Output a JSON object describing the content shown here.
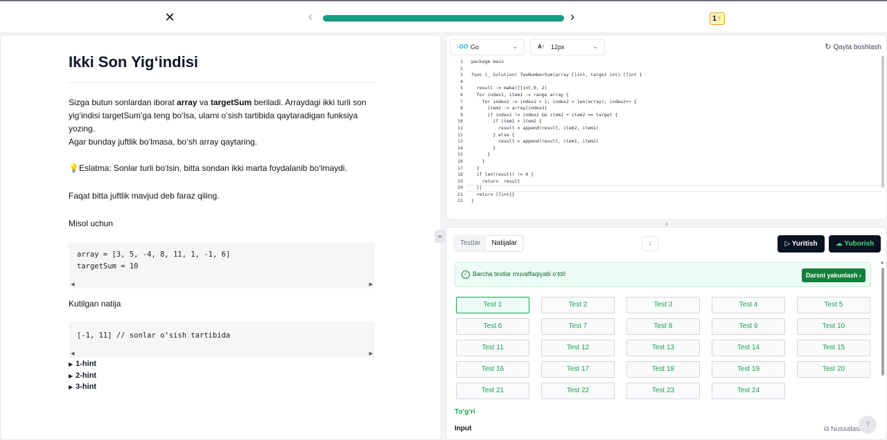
{
  "topbar": {
    "close_glyph": "✕",
    "prev_glyph": "‹",
    "next_glyph": "›",
    "progress_percent": 100,
    "streak_count": "1",
    "streak_icon": "lightning-icon"
  },
  "problem": {
    "title": "Ikki Son Yig‘indisi",
    "intro_1": "Sizga butun sonlardan iborat ",
    "intro_array": "array",
    "intro_2": " va ",
    "intro_target": "targetSum",
    "intro_3": " beriladi. Arraydagi ikki turli son yig‘indisi targetSum'ga teng bo‘lsa, ularni o‘sish tartibida qaytaradigan funksiya yozing.",
    "no_pair": "Agar bunday juftlik bo‘lmasa, bo‘sh array qaytaring.",
    "note_icon": "lightbulb-icon",
    "note": "Eslatma: Sonlar turli bo‘lsin, bitta sondan ikki marta foydalanib bo‘lmaydi.",
    "assume": "Faqat bitta juftlik mavjud deb faraz qiling.",
    "example_label": "Misol uchun",
    "example_code": "array = [3, 5, -4, 8, 11, 1, -1, 6]\ntargetSum = 10",
    "expected_label": "Kutilgan natija",
    "expected_code": "[-1, 11] // sonlar o‘sish tartibida",
    "hints": [
      "1-hint",
      "2-hint",
      "3-hint"
    ]
  },
  "editor": {
    "language": "Go",
    "font_size": "12px",
    "reset_label": "Qayta boshlash",
    "code_lines": [
      "package main",
      "",
      "func (_ Solution) TwoNumberSum(array []int, target int) []int {",
      "",
      "  result := make([]int,0, 2)",
      "  for index1, item1 := range array {",
      "    for index2 := index1 + 1; index2 < len(array); index2++ {",
      "      item2 := array[index2]",
      "      if index1 != index2 && item1 + item2 == target {",
      "        if item1 > item2 {",
      "          result = append(result, item2, item1)",
      "        } else {",
      "          result = append(result, item1, item2)",
      "        }",
      "      }",
      "    }",
      "  }",
      "  if len(result) != 0 {",
      "    return  result",
      "  }|",
      "  return []int{}",
      "}"
    ]
  },
  "results": {
    "tabs": [
      "Testlar",
      "Natijalar"
    ],
    "active_tab": "Natijalar",
    "run_label": "Yuritish",
    "submit_label": "Yuborish",
    "success_message": "Barcha testlar muvaffaqiyatli o‘tdi!",
    "finish_label": "Darsni yakunlash",
    "tests": [
      "Test 1",
      "Test 2",
      "Test 3",
      "Test 4",
      "Test 5",
      "Test 6",
      "Test 7",
      "Test 8",
      "Test 9",
      "Test 10",
      "Test 11",
      "Test 12",
      "Test 13",
      "Test 14",
      "Test 15",
      "Test 16",
      "Test 17",
      "Test 18",
      "Test 19",
      "Test 20",
      "Test 21",
      "Test 22",
      "Test 23",
      "Test 24"
    ],
    "selected_test": "Test 1",
    "verdict": "To‘g‘ri",
    "input_label": "Input",
    "copy_label": "Nusxalash",
    "help_label": "?"
  },
  "colors": {
    "accent_green": "#16a34a",
    "progress_teal": "#14a085",
    "dark_button": "#0b1220"
  }
}
